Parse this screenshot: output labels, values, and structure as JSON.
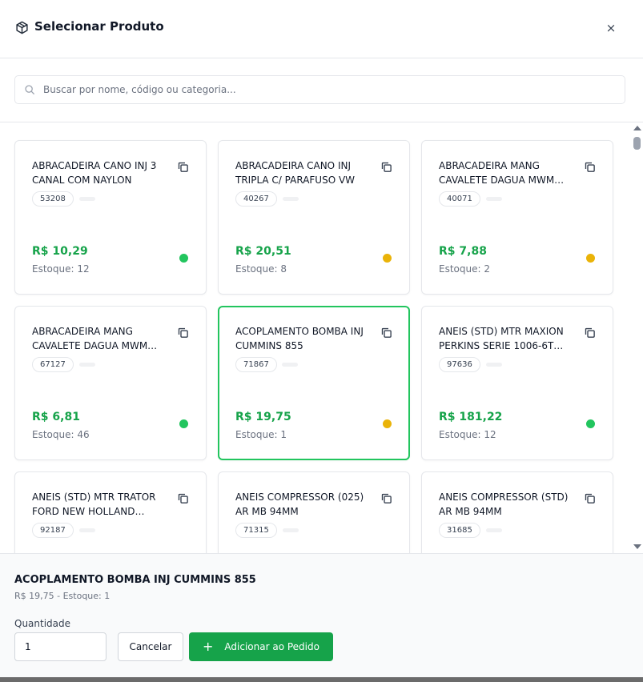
{
  "header": {
    "title": "Selecionar Produto",
    "icon": "package-icon",
    "close_label": "×"
  },
  "search": {
    "placeholder": "Buscar por nome, código ou categoria...",
    "value": ""
  },
  "products": [
    {
      "name": "ABRACADEIRA CANO INJ 3 CANAL COM NAYLON",
      "code": "53208",
      "price": "R$ 10,29",
      "stock": "Estoque: 12",
      "status_color": "#22c55e"
    },
    {
      "name": "ABRACADEIRA CANO INJ TRIPLA C/ PARAFUSO VW",
      "code": "40267",
      "price": "R$ 20,51",
      "stock": "Estoque: 8",
      "status_color": "#eab308"
    },
    {
      "name": "ABRACADEIRA MANG CAVALETE DAGUA MWM D229 e…",
      "code": "40071",
      "price": "R$ 7,88",
      "stock": "Estoque: 2",
      "status_color": "#eab308"
    },
    {
      "name": "ABRACADEIRA MANG CAVALETE DAGUA MWM D229 e…",
      "code": "67127",
      "price": "R$ 6,81",
      "stock": "Estoque: 46",
      "status_color": "#22c55e"
    },
    {
      "name": "ACOPLAMENTO BOMBA INJ CUMMINS 855",
      "code": "71867",
      "price": "R$ 19,75",
      "stock": "Estoque: 1",
      "status_color": "#eab308",
      "selected": true
    },
    {
      "name": "ANEIS (STD) MTR MAXION PERKINS SERIE 1006-6T 100M…",
      "code": "97636",
      "price": "R$ 181,22",
      "stock": "Estoque: 12",
      "status_color": "#22c55e"
    },
    {
      "name": "ANEIS (STD) MTR TRATOR FORD NEW HOLLAND 5030…",
      "code": "92187",
      "price": "",
      "stock": "",
      "status_color": ""
    },
    {
      "name": "ANEIS COMPRESSOR (025) AR MB 94MM",
      "code": "71315",
      "price": "",
      "stock": "",
      "status_color": ""
    },
    {
      "name": "ANEIS COMPRESSOR (STD) AR MB 94MM",
      "code": "31685",
      "price": "",
      "stock": "",
      "status_color": ""
    }
  ],
  "footer": {
    "selected_name": "ACOPLAMENTO BOMBA INJ CUMMINS 855",
    "selected_info": "R$ 19,75 - Estoque: 1",
    "quantity_label": "Quantidade",
    "quantity_value": "1",
    "cancel_label": "Cancelar",
    "add_label": "Adicionar ao Pedido"
  },
  "colors": {
    "accent": "#16a34a",
    "in_stock": "#22c55e",
    "low_stock": "#eab308"
  }
}
